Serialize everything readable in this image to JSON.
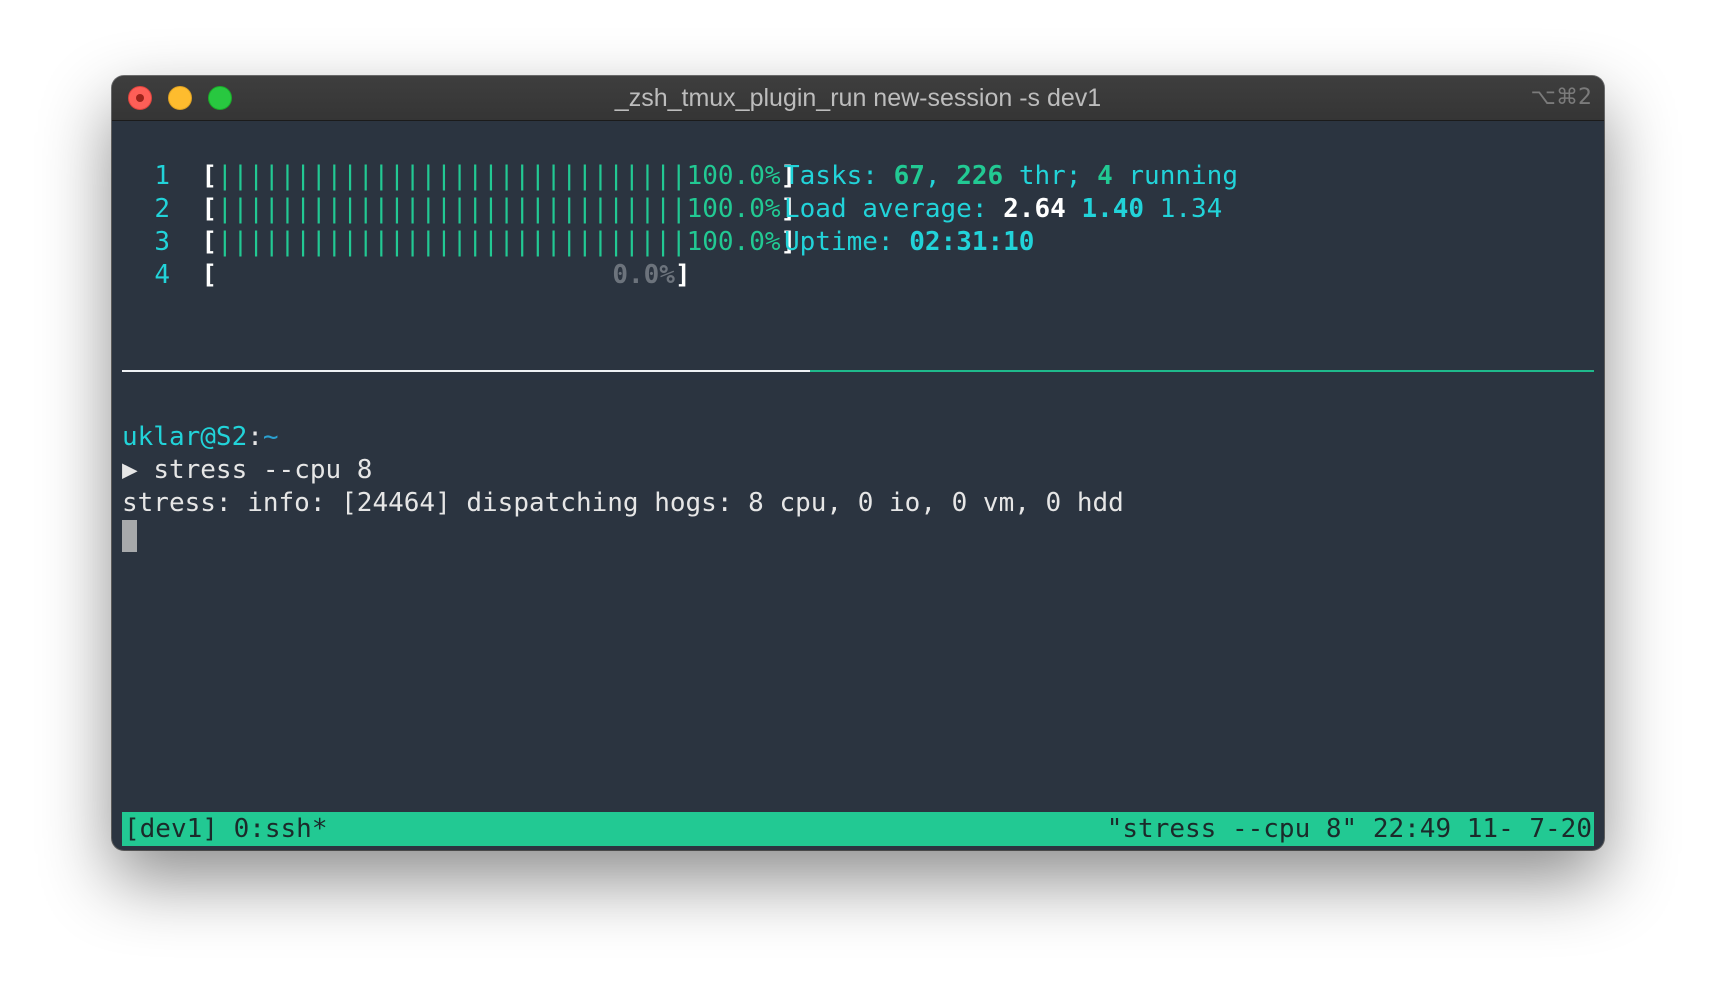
{
  "window": {
    "title": "_zsh_tmux_plugin_run new-session -s dev1",
    "shortcut": "⌥⌘2"
  },
  "htop": {
    "cpus": [
      {
        "num": "1",
        "bar": "||||||||||||||||||||||||||||||",
        "percent": "100.0%",
        "usage": 1.0
      },
      {
        "num": "2",
        "bar": "||||||||||||||||||||||||||||||",
        "percent": "100.0%",
        "usage": 1.0
      },
      {
        "num": "3",
        "bar": "||||||||||||||||||||||||||||||",
        "percent": "100.0%",
        "usage": 1.0
      },
      {
        "num": "4",
        "bar": "",
        "percent": "0.0%",
        "usage": 0.0
      }
    ],
    "tasks_label": "Tasks: ",
    "tasks_count": "67",
    "tasks_sep": ", ",
    "threads_count": "226",
    "threads_label": " thr; ",
    "running_count": "4",
    "running_label": " running",
    "load_label": "Load average: ",
    "load_1": "2.64",
    "load_5": "1.40",
    "load_15": "1.34",
    "uptime_label": "Uptime: ",
    "uptime_value": "02:31:10"
  },
  "shell": {
    "user_host": "uklar@S2",
    "colon": ":",
    "path": "~",
    "prompt_symbol": "▶",
    "command": "stress --cpu 8",
    "output": "stress: info: [24464] dispatching hogs: 8 cpu, 0 io, 0 vm, 0 hdd"
  },
  "tmux": {
    "session_tabs": "[dev1] 0:ssh*",
    "status_right": "\"stress --cpu 8\" 22:49 11- 7-20"
  },
  "colors": {
    "terminal_bg": "#2b3440",
    "accent_green": "#22c993",
    "accent_cyan": "#22d3d9"
  }
}
